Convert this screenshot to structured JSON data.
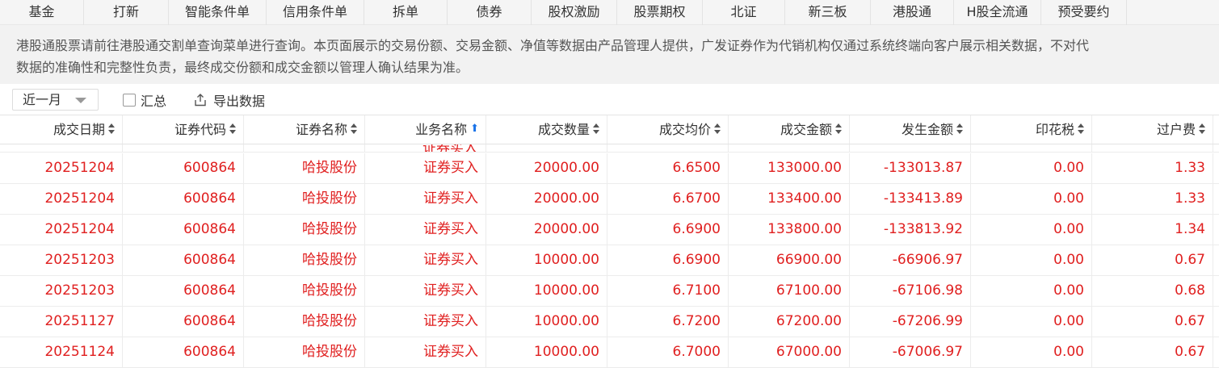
{
  "topnav": {
    "tabs": [
      {
        "label": "基金"
      },
      {
        "label": "打新"
      },
      {
        "label": "智能条件单"
      },
      {
        "label": "信用条件单"
      },
      {
        "label": "拆单"
      },
      {
        "label": "债券"
      },
      {
        "label": "股权激励"
      },
      {
        "label": "股票期权"
      },
      {
        "label": "北证"
      },
      {
        "label": "新三板"
      },
      {
        "label": "港股通"
      },
      {
        "label": "H股全流通"
      },
      {
        "label": "预受要约"
      }
    ]
  },
  "notice": {
    "line1": "港股通股票请前往港股通交割单查询菜单进行查询。本页面展示的交易份额、交易金额、净值等数据由产品管理人提供，广发证券作为代销机构仅通过系统终端向客户展示相关数据，不对代",
    "line2": "数据的准确性和完整性负责，最终成交份额和成交金额以管理人确认结果为准。"
  },
  "toolbar": {
    "period_value": "近一月",
    "summary_label": "汇总",
    "export_label": "导出数据"
  },
  "table": {
    "columns": [
      "成交日期",
      "证券代码",
      "证券名称",
      "业务名称",
      "成交数量",
      "成交均价",
      "成交金额",
      "发生金额",
      "印花税",
      "过户费"
    ],
    "active_sort_column": "业务名称",
    "partial_row_text": "证券买入",
    "rows": [
      [
        "20251204",
        "600864",
        "哈投股份",
        "证券买入",
        "20000.00",
        "6.6500",
        "133000.00",
        "-133013.87",
        "0.00",
        "1.33"
      ],
      [
        "20251204",
        "600864",
        "哈投股份",
        "证券买入",
        "20000.00",
        "6.6700",
        "133400.00",
        "-133413.89",
        "0.00",
        "1.33"
      ],
      [
        "20251204",
        "600864",
        "哈投股份",
        "证券买入",
        "20000.00",
        "6.6900",
        "133800.00",
        "-133813.92",
        "0.00",
        "1.34"
      ],
      [
        "20251203",
        "600864",
        "哈投股份",
        "证券买入",
        "10000.00",
        "6.6900",
        "66900.00",
        "-66906.97",
        "0.00",
        "0.67"
      ],
      [
        "20251203",
        "600864",
        "哈投股份",
        "证券买入",
        "10000.00",
        "6.7100",
        "67100.00",
        "-67106.98",
        "0.00",
        "0.68"
      ],
      [
        "20251127",
        "600864",
        "哈投股份",
        "证券买入",
        "10000.00",
        "6.7200",
        "67200.00",
        "-67206.99",
        "0.00",
        "0.67"
      ],
      [
        "20251124",
        "600864",
        "哈投股份",
        "证券买入",
        "10000.00",
        "6.7000",
        "67000.00",
        "-67006.97",
        "0.00",
        "0.67"
      ]
    ]
  },
  "colors": {
    "data_text": "#e02020",
    "sort_active": "#1a73e8"
  }
}
